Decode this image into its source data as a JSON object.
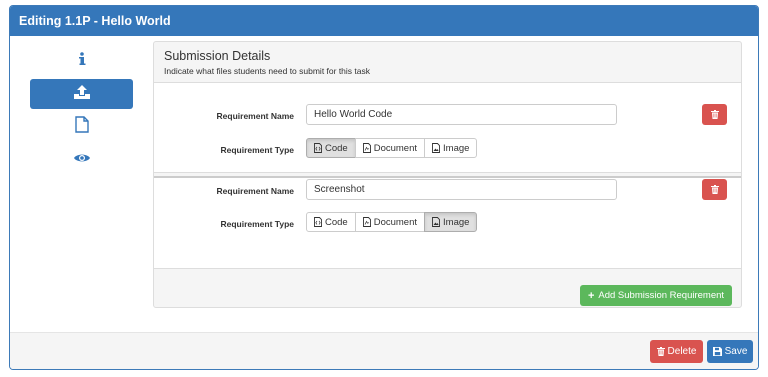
{
  "modal": {
    "title": "Editing 1.1P - Hello World"
  },
  "sidebar": {
    "items": [
      {
        "icon": "info-icon",
        "active": false
      },
      {
        "icon": "upload-icon",
        "active": true
      },
      {
        "icon": "file-icon",
        "active": false
      },
      {
        "icon": "eye-icon",
        "active": false
      }
    ]
  },
  "panel": {
    "title": "Submission Details",
    "subtitle": "Indicate what files students need to submit for this task"
  },
  "requirements": [
    {
      "name_label": "Requirement Name",
      "name_value": "Hello World Code",
      "type_label": "Requirement Type",
      "types": [
        "Code",
        "Document",
        "Image"
      ],
      "selected_type": "Code"
    },
    {
      "name_label": "Requirement Name",
      "name_value": "Screenshot",
      "type_label": "Requirement Type",
      "types": [
        "Code",
        "Document",
        "Image"
      ],
      "selected_type": "Image"
    }
  ],
  "add_button": {
    "label": "Add Submission Requirement"
  },
  "footer": {
    "delete_label": "Delete",
    "save_label": "Save"
  },
  "colors": {
    "primary": "#3577ba",
    "danger": "#d9534f",
    "success": "#5cb85c"
  }
}
